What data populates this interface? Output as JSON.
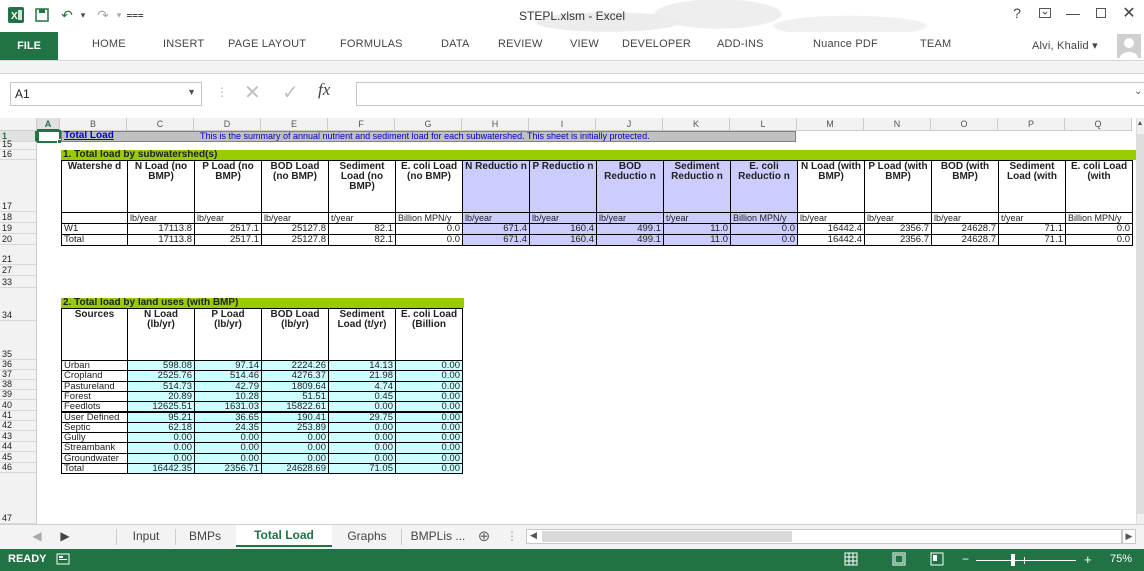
{
  "window": {
    "title": "STEPL.xlsm - Excel",
    "user": "Alvi, Khalid",
    "help": "?"
  },
  "ribbon": {
    "tabs": [
      "FILE",
      "HOME",
      "INSERT",
      "PAGE LAYOUT",
      "FORMULAS",
      "DATA",
      "REVIEW",
      "VIEW",
      "DEVELOPER",
      "ADD-INS",
      "Nuance PDF",
      "TEAM"
    ]
  },
  "formula_bar": {
    "name_box": "A1",
    "fx": "fx",
    "content": ""
  },
  "columns": [
    "A",
    "B",
    "C",
    "D",
    "E",
    "F",
    "G",
    "H",
    "I",
    "J",
    "K",
    "L",
    "M",
    "N",
    "O",
    "P",
    "Q"
  ],
  "row_numbers": [
    "1",
    "15",
    "16",
    "17",
    "18",
    "19",
    "20",
    "21",
    "27",
    "33",
    "34",
    "35",
    "36",
    "37",
    "38",
    "39",
    "40",
    "41",
    "42",
    "43",
    "44",
    "45",
    "46",
    "47"
  ],
  "banner": {
    "label": "Total Load",
    "text": "This is the summary of annual nutrient and sediment load for each subwatershed. This sheet is initially protected."
  },
  "section1": {
    "title": "1. Total load by subwatershed(s)",
    "headers": [
      "Watershe d",
      "N Load (no BMP)",
      "P Load (no BMP)",
      "BOD Load (no BMP)",
      "Sediment Load (no BMP)",
      "E. coli Load (no BMP)",
      "N Reductio n",
      "P Reductio n",
      "BOD Reductio n",
      "Sediment Reductio n",
      "E. coli Reductio n",
      "N Load (with BMP)",
      "P Load (with BMP)",
      "BOD (with BMP)",
      "Sediment Load (with",
      "E. coli Load (with"
    ],
    "units": [
      "",
      "lb/year",
      "lb/year",
      "lb/year",
      "t/year",
      "Billion MPN/y",
      "lb/year",
      "lb/year",
      "lb/year",
      "t/year",
      "Billion MPN/y",
      "lb/year",
      "lb/year",
      "lb/year",
      "t/year",
      "Billion MPN/y"
    ],
    "rows": [
      [
        "W1",
        "17113.8",
        "2517.1",
        "25127.8",
        "82.1",
        "0.0",
        "671.4",
        "160.4",
        "499.1",
        "11.0",
        "0.0",
        "16442.4",
        "2356.7",
        "24628.7",
        "71.1",
        "0.0"
      ],
      [
        "Total",
        "17113.8",
        "2517.1",
        "25127.8",
        "82.1",
        "0.0",
        "671.4",
        "160.4",
        "499.1",
        "11.0",
        "0.0",
        "16442.4",
        "2356.7",
        "24628.7",
        "71.1",
        "0.0"
      ]
    ]
  },
  "section2": {
    "title": "2. Total load by land uses (with BMP)",
    "headers": [
      "Sources",
      "N Load (lb/yr)",
      "P Load (lb/yr)",
      "BOD Load (lb/yr)",
      "Sediment Load (t/yr)",
      "E. coli Load (Billion"
    ],
    "rows": [
      [
        "Urban",
        "598.08",
        "97.14",
        "2224.26",
        "14.13",
        "0.00"
      ],
      [
        "Cropland",
        "2525.76",
        "514.46",
        "4276.37",
        "21.98",
        "0.00"
      ],
      [
        "Pastureland",
        "514.73",
        "42.79",
        "1809.64",
        "4.74",
        "0.00"
      ],
      [
        "Forest",
        "20.89",
        "10.28",
        "51.51",
        "0.45",
        "0.00"
      ],
      [
        "Feedlots",
        "12625.51",
        "1631.03",
        "15822.61",
        "0.00",
        "0.00"
      ],
      [
        "User Defined",
        "95.21",
        "36.65",
        "190.41",
        "29.75",
        "0.00"
      ],
      [
        "Septic",
        "62.18",
        "24.35",
        "253.89",
        "0.00",
        "0.00"
      ],
      [
        "Gully",
        "0.00",
        "0.00",
        "0.00",
        "0.00",
        "0.00"
      ],
      [
        "Streambank",
        "0.00",
        "0.00",
        "0.00",
        "0.00",
        "0.00"
      ],
      [
        "Groundwater",
        "0.00",
        "0.00",
        "0.00",
        "0.00",
        "0.00"
      ],
      [
        "Total",
        "16442.35",
        "2356.71",
        "24628.69",
        "71.05",
        "0.00"
      ]
    ]
  },
  "sheet_tabs": [
    "Input",
    "BMPs",
    "Total Load",
    "Graphs",
    "BMPLis ..."
  ],
  "status": {
    "ready": "READY",
    "zoom": "75%"
  },
  "colors": {
    "excel_green": "#217346",
    "header_green": "#99cc00",
    "reduction_lavender": "#ccccff",
    "cyan": "#ccffff"
  }
}
